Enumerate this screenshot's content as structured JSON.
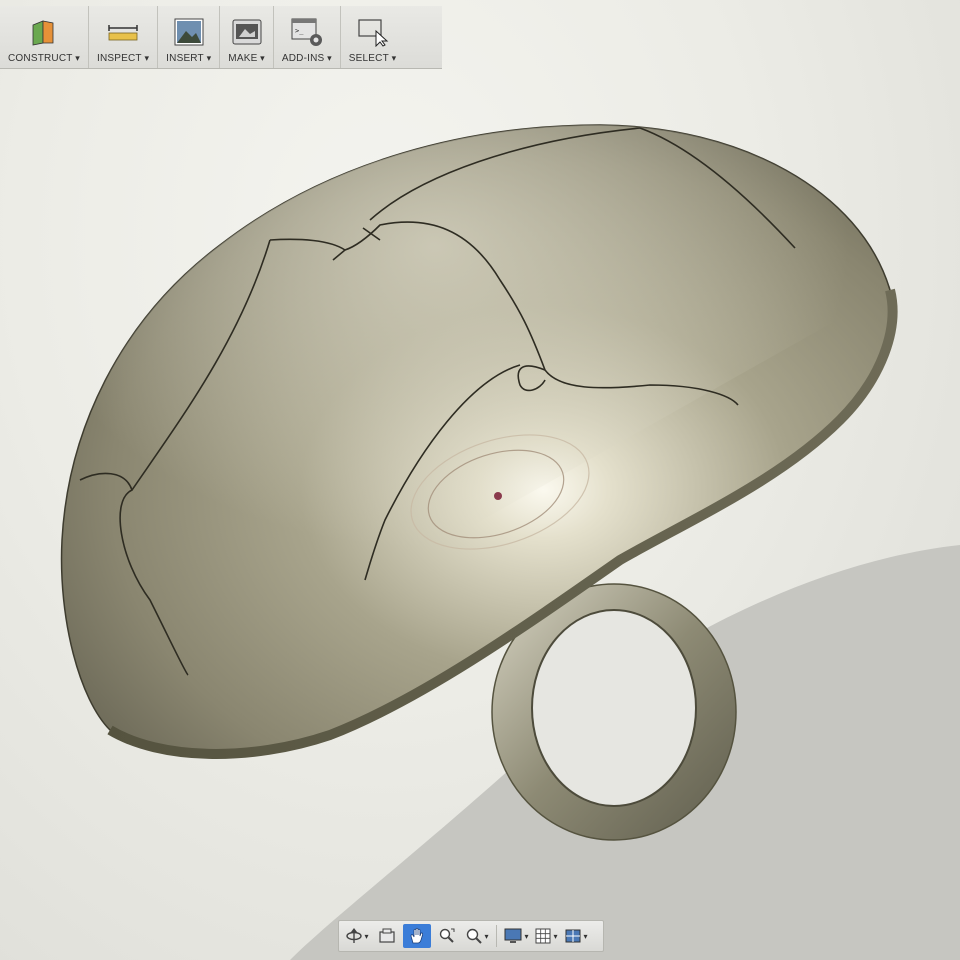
{
  "toolbar": {
    "groups": [
      {
        "label": "CONSTRUCT",
        "icon": "construct-plane-icon"
      },
      {
        "label": "INSPECT",
        "icon": "measure-ruler-icon"
      },
      {
        "label": "INSERT",
        "icon": "insert-image-icon"
      },
      {
        "label": "MAKE",
        "icon": "make-3d-print-icon"
      },
      {
        "label": "ADD-INS",
        "icon": "add-ins-script-icon"
      },
      {
        "label": "SELECT",
        "icon": "select-cursor-icon"
      }
    ]
  },
  "viewport": {
    "model": "dome-pendant-with-ring",
    "model_color": "#8f8b74",
    "shadow_color": "#c9c9c4"
  },
  "navbar": {
    "buttons": [
      {
        "icon": "orbit-icon",
        "dropdown": true
      },
      {
        "icon": "look-at-icon",
        "dropdown": false
      },
      {
        "icon": "pan-hand-icon",
        "dropdown": false,
        "active": true
      },
      {
        "icon": "zoom-window-icon",
        "dropdown": false
      },
      {
        "icon": "zoom-icon",
        "dropdown": true
      },
      {
        "icon": "display-settings-icon",
        "dropdown": true
      },
      {
        "icon": "grid-settings-icon",
        "dropdown": true
      },
      {
        "icon": "viewports-icon",
        "dropdown": true
      }
    ],
    "accent": "#3b7dd8"
  }
}
